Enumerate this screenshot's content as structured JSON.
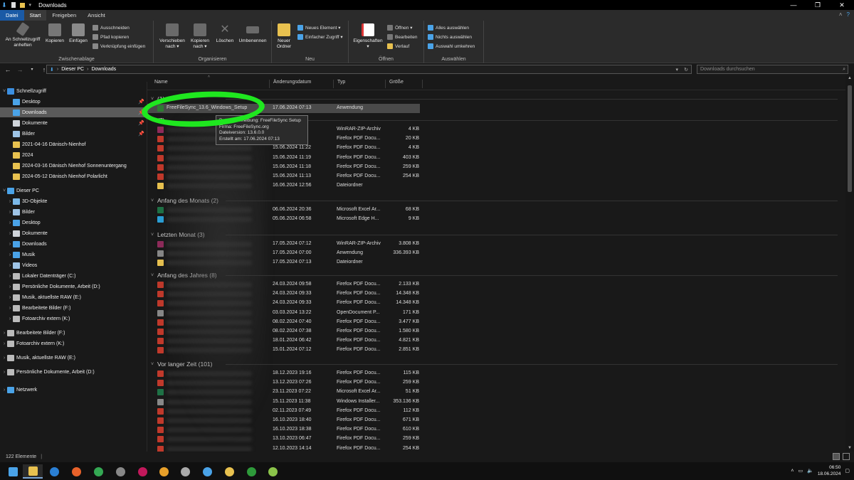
{
  "window": {
    "title": "Downloads",
    "controls": [
      "—",
      "❐",
      "✕"
    ]
  },
  "tabs": [
    "Datei",
    "Start",
    "Freigeben",
    "Ansicht"
  ],
  "ribbon": {
    "groups": {
      "clipboard": "Zwischenablage",
      "organize": "Organisieren",
      "new": "Neu",
      "open": "Öffnen",
      "select": "Auswählen"
    },
    "pin_label_1": "An Schnellzugriff",
    "pin_label_2": "anheften",
    "copy": "Kopieren",
    "paste": "Einfügen",
    "cut": "Ausschneiden",
    "copy_path": "Pfad kopieren",
    "paste_shortcut": "Verknüpfung einfügen",
    "move_1": "Verschieben",
    "move_2": "nach ▾",
    "copyto_1": "Kopieren",
    "copyto_2": "nach ▾",
    "delete": "Löschen",
    "rename": "Umbenennen",
    "newfolder_1": "Neuer",
    "newfolder_2": "Ordner",
    "new_item": "Neues Element ▾",
    "easy_access": "Einfacher Zugriff ▾",
    "properties": "Eigenschaften",
    "open_btn": "Öffnen ▾",
    "edit": "Bearbeiten",
    "history": "Verlauf",
    "select_all": "Alles auswählen",
    "select_none": "Nichts auswählen",
    "invert": "Auswahl umkehren"
  },
  "address": {
    "path": [
      "Dieser PC",
      "Downloads"
    ],
    "search_placeholder": "Downloads durchsuchen"
  },
  "nav": [
    {
      "label": "Schnellzugriff",
      "level": 0,
      "icon": "star-icon",
      "color": "#3b8fe0"
    },
    {
      "label": "Desktop",
      "level": 1,
      "icon": "folder-icon",
      "color": "#4aa3e8",
      "pin": true
    },
    {
      "label": "Downloads",
      "level": 1,
      "icon": "download-icon",
      "color": "#4aa3e8",
      "pin": true,
      "selected": true
    },
    {
      "label": "Dokumente",
      "level": 1,
      "icon": "folder-icon",
      "color": "#cfd4da",
      "pin": true
    },
    {
      "label": "Bilder",
      "level": 1,
      "icon": "folder-icon",
      "color": "#9ec4e6",
      "pin": true
    },
    {
      "label": "2021-04-16 Dänisch-Nienhof",
      "level": 1,
      "icon": "folder-icon",
      "color": "#e8c14f"
    },
    {
      "label": "2024",
      "level": 1,
      "icon": "folder-icon",
      "color": "#e8c14f"
    },
    {
      "label": "2024-03-16 Dänisch Nienhof Sonnenuntergang",
      "level": 1,
      "icon": "folder-icon",
      "color": "#e8c14f"
    },
    {
      "label": "2024-05-12 Dänisch Nienhof Polarlicht",
      "level": 1,
      "icon": "folder-icon",
      "color": "#e8c14f"
    },
    {
      "label": "Dieser PC",
      "level": 0,
      "icon": "pc-icon",
      "color": "#4aa3e8"
    },
    {
      "label": "3D-Objekte",
      "level": 1,
      "icon": "cube-icon",
      "color": "#7ab8e8"
    },
    {
      "label": "Bilder",
      "level": 1,
      "icon": "folder-icon",
      "color": "#9ec4e6"
    },
    {
      "label": "Desktop",
      "level": 1,
      "icon": "folder-icon",
      "color": "#4aa3e8"
    },
    {
      "label": "Dokumente",
      "level": 1,
      "icon": "folder-icon",
      "color": "#cfd4da"
    },
    {
      "label": "Downloads",
      "level": 1,
      "icon": "download-icon",
      "color": "#4aa3e8"
    },
    {
      "label": "Musik",
      "level": 1,
      "icon": "music-icon",
      "color": "#4aa3e8"
    },
    {
      "label": "Videos",
      "level": 1,
      "icon": "video-icon",
      "color": "#9ec4e6"
    },
    {
      "label": "Lokaler Datenträger (C:)",
      "level": 1,
      "icon": "drive-icon",
      "color": "#bbbbbb"
    },
    {
      "label": "Persönliche Dokumente, Arbeit (D:)",
      "level": 1,
      "icon": "drive-icon",
      "color": "#bbbbbb"
    },
    {
      "label": "Musik, aktuellste RAW (E:)",
      "level": 1,
      "icon": "drive-icon",
      "color": "#bbbbbb"
    },
    {
      "label": "Bearbeitete Bilder (F:)",
      "level": 1,
      "icon": "drive-icon",
      "color": "#bbbbbb"
    },
    {
      "label": "Fotoarchiv extern (K:)",
      "level": 1,
      "icon": "drive-icon",
      "color": "#bbbbbb"
    },
    {
      "label": "Bearbeitete Bilder (F:)",
      "level": 0,
      "icon": "drive-icon",
      "color": "#bbbbbb"
    },
    {
      "label": "Fotoarchiv extern (K:)",
      "level": 0,
      "icon": "drive-icon",
      "color": "#bbbbbb"
    },
    {
      "label": "Musik, aktuellste RAW (E:)",
      "level": 0,
      "icon": "drive-icon",
      "color": "#bbbbbb"
    },
    {
      "label": "Persönliche Dokumente, Arbeit (D:)",
      "level": 0,
      "icon": "drive-icon",
      "color": "#bbbbbb"
    },
    {
      "label": "Netzwerk",
      "level": 0,
      "icon": "network-icon",
      "color": "#4aa3e8"
    }
  ],
  "columns": [
    "Name",
    "Änderungsdatum",
    "Typ",
    "Größe"
  ],
  "groups": [
    {
      "title": "(1)",
      "rows": [
        {
          "name": "FreeFileSync_13.6_Windows_Setup",
          "date": "17.06.2024 07:13",
          "type": "Anwendung",
          "size": "20.037 KB",
          "icon": "#2e7d32",
          "highlight": true
        }
      ]
    },
    {
      "title": "(7)",
      "rows": [
        {
          "name": "",
          "date": "",
          "type": "WinRAR-ZIP-Archiv",
          "size": "4 KB",
          "icon": "#8e2a5a"
        },
        {
          "name": "",
          "date": "",
          "type": "Firefox PDF Docu...",
          "size": "20 KB",
          "icon": "#c0392b"
        },
        {
          "name": "",
          "date": "15.06.2024 11:22",
          "type": "Firefox PDF Docu...",
          "size": "4 KB",
          "icon": "#c0392b"
        },
        {
          "name": "",
          "date": "15.06.2024 11:19",
          "type": "Firefox PDF Docu...",
          "size": "403 KB",
          "icon": "#c0392b"
        },
        {
          "name": "",
          "date": "15.06.2024 11:18",
          "type": "Firefox PDF Docu...",
          "size": "259 KB",
          "icon": "#c0392b"
        },
        {
          "name": "",
          "date": "15.06.2024 11:13",
          "type": "Firefox PDF Docu...",
          "size": "254 KB",
          "icon": "#c0392b"
        },
        {
          "name": "",
          "date": "16.06.2024 12:56",
          "type": "Dateiordner",
          "size": "",
          "icon": "#e8c14f"
        }
      ]
    },
    {
      "title": "Anfang des Monats (2)",
      "rows": [
        {
          "name": "",
          "date": "06.06.2024 20:36",
          "type": "Microsoft Excel Ar...",
          "size": "68 KB",
          "icon": "#1e7145"
        },
        {
          "name": "",
          "date": "05.06.2024 06:58",
          "type": "Microsoft Edge H...",
          "size": "9 KB",
          "icon": "#2a9fd6"
        }
      ]
    },
    {
      "title": "Letzten Monat (3)",
      "rows": [
        {
          "name": "",
          "date": "17.05.2024 07:12",
          "type": "WinRAR-ZIP-Archiv",
          "size": "3.808 KB",
          "icon": "#8e2a5a"
        },
        {
          "name": "",
          "date": "17.05.2024 07:00",
          "type": "Anwendung",
          "size": "336.393 KB",
          "icon": "#888888"
        },
        {
          "name": "",
          "date": "17.05.2024 07:13",
          "type": "Dateiordner",
          "size": "",
          "icon": "#e8c14f"
        }
      ]
    },
    {
      "title": "Anfang des Jahres (8)",
      "rows": [
        {
          "name": "",
          "date": "24.03.2024 09:58",
          "type": "Firefox PDF Docu...",
          "size": "2.133 KB",
          "icon": "#c0392b"
        },
        {
          "name": "",
          "date": "24.03.2024 09:33",
          "type": "Firefox PDF Docu...",
          "size": "14.348 KB",
          "icon": "#c0392b"
        },
        {
          "name": "",
          "date": "24.03.2024 09:33",
          "type": "Firefox PDF Docu...",
          "size": "14.348 KB",
          "icon": "#c0392b"
        },
        {
          "name": "",
          "date": "03.03.2024 13:22",
          "type": "OpenDocument P...",
          "size": "171 KB",
          "icon": "#888888"
        },
        {
          "name": "",
          "date": "08.02.2024 07:40",
          "type": "Firefox PDF Docu...",
          "size": "3.477 KB",
          "icon": "#c0392b"
        },
        {
          "name": "",
          "date": "08.02.2024 07:38",
          "type": "Firefox PDF Docu...",
          "size": "1.580 KB",
          "icon": "#c0392b"
        },
        {
          "name": "",
          "date": "18.01.2024 06:42",
          "type": "Firefox PDF Docu...",
          "size": "4.821 KB",
          "icon": "#c0392b"
        },
        {
          "name": "",
          "date": "15.01.2024 07:12",
          "type": "Firefox PDF Docu...",
          "size": "2.851 KB",
          "icon": "#c0392b"
        }
      ]
    },
    {
      "title": "Vor langer Zeit (101)",
      "rows": [
        {
          "name": "",
          "date": "18.12.2023 19:16",
          "type": "Firefox PDF Docu...",
          "size": "115 KB",
          "icon": "#c0392b"
        },
        {
          "name": "",
          "date": "13.12.2023 07:26",
          "type": "Firefox PDF Docu...",
          "size": "259 KB",
          "icon": "#c0392b"
        },
        {
          "name": "",
          "date": "23.11.2023 07:22",
          "type": "Microsoft Excel Ar...",
          "size": "51 KB",
          "icon": "#1e7145"
        },
        {
          "name": "",
          "date": "15.11.2023 11:38",
          "type": "Windows Installer...",
          "size": "353.136 KB",
          "icon": "#888888"
        },
        {
          "name": "",
          "date": "02.11.2023 07:49",
          "type": "Firefox PDF Docu...",
          "size": "112 KB",
          "icon": "#c0392b"
        },
        {
          "name": "",
          "date": "16.10.2023 18:40",
          "type": "Firefox PDF Docu...",
          "size": "671 KB",
          "icon": "#c0392b"
        },
        {
          "name": "",
          "date": "16.10.2023 18:38",
          "type": "Firefox PDF Docu...",
          "size": "610 KB",
          "icon": "#c0392b"
        },
        {
          "name": "",
          "date": "13.10.2023 06:47",
          "type": "Firefox PDF Docu...",
          "size": "259 KB",
          "icon": "#c0392b"
        },
        {
          "name": "",
          "date": "12.10.2023 14:14",
          "type": "Firefox PDF Docu...",
          "size": "254 KB",
          "icon": "#c0392b"
        }
      ]
    }
  ],
  "tooltip": {
    "line1": "Dateibeschreibung: FreeFileSync Setup",
    "line2": "Firma: FreeFileSync.org",
    "line3": "Dateiversion: 13.6.0.0",
    "line4": "Erstellt am: 17.06.2024 07:13"
  },
  "status": {
    "count": "122 Elemente"
  },
  "taskbar": {
    "apps": [
      {
        "name": "start-icon",
        "color": "#4aa3e8"
      },
      {
        "name": "explorer-icon",
        "color": "#e8c14f",
        "active": true
      },
      {
        "name": "app-blue-icon",
        "color": "#2a7fd4"
      },
      {
        "name": "firefox-icon",
        "color": "#e8622a"
      },
      {
        "name": "chrome-icon",
        "color": "#34a853"
      },
      {
        "name": "app-dark-icon",
        "color": "#888888"
      },
      {
        "name": "app-colorful-icon",
        "color": "#c2185b"
      },
      {
        "name": "app-orange-icon",
        "color": "#e8a02a"
      },
      {
        "name": "app-mono-icon",
        "color": "#aaaaaa"
      },
      {
        "name": "app-feather-icon",
        "color": "#4aa3e8"
      },
      {
        "name": "app-tools-icon",
        "color": "#e8c14f"
      },
      {
        "name": "app-green-icon",
        "color": "#2e9a3a"
      },
      {
        "name": "app-yellowgreen-icon",
        "color": "#8bc34a"
      }
    ],
    "time": "06:50",
    "date": "18.06.2024"
  }
}
